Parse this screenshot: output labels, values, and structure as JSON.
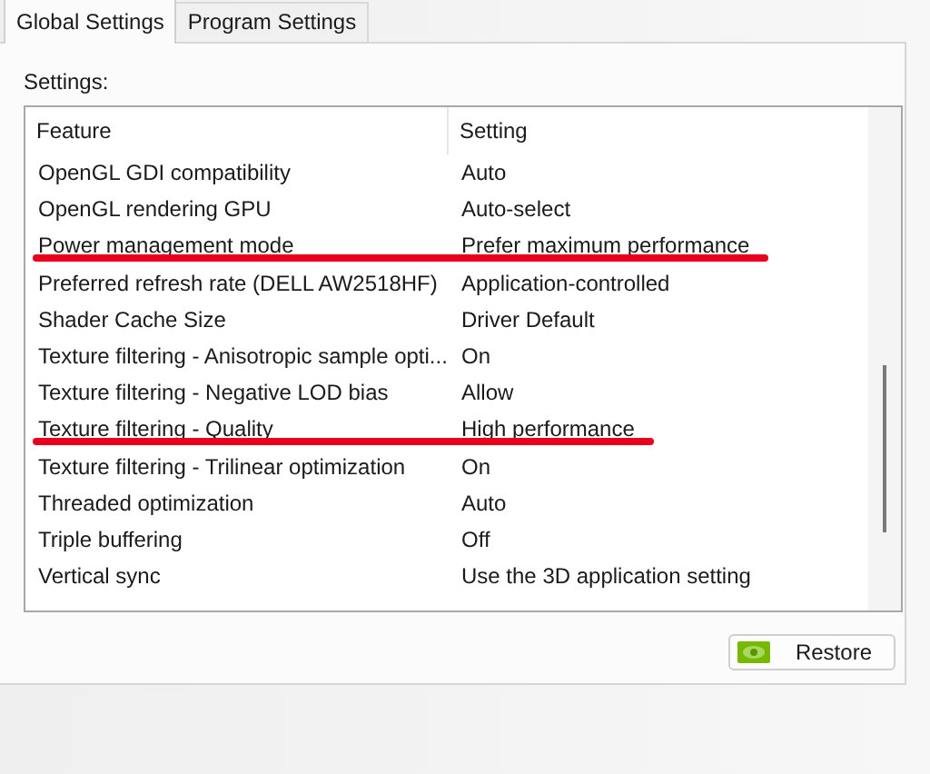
{
  "tabs": [
    {
      "label": "Global Settings",
      "selected": true
    },
    {
      "label": "Program Settings",
      "selected": false
    }
  ],
  "settings_label": "Settings:",
  "table": {
    "columns": [
      "Feature",
      "Setting"
    ],
    "rows": [
      {
        "feature": "OpenGL GDI compatibility",
        "setting": "Auto",
        "highlighted": false
      },
      {
        "feature": "OpenGL rendering GPU",
        "setting": "Auto-select",
        "highlighted": false
      },
      {
        "feature": "Power management mode",
        "setting": "Prefer maximum performance",
        "highlighted": true
      },
      {
        "feature": "Preferred refresh rate (DELL AW2518HF)",
        "setting": "Application-controlled",
        "highlighted": false
      },
      {
        "feature": "Shader Cache Size",
        "setting": "Driver Default",
        "highlighted": false
      },
      {
        "feature": "Texture filtering - Anisotropic sample opti...",
        "setting": "On",
        "highlighted": false
      },
      {
        "feature": "Texture filtering - Negative LOD bias",
        "setting": "Allow",
        "highlighted": false
      },
      {
        "feature": "Texture filtering - Quality",
        "setting": "High performance",
        "highlighted": true
      },
      {
        "feature": "Texture filtering - Trilinear optimization",
        "setting": "On",
        "highlighted": false
      },
      {
        "feature": "Threaded optimization",
        "setting": "Auto",
        "highlighted": false
      },
      {
        "feature": "Triple buffering",
        "setting": "Off",
        "highlighted": false
      },
      {
        "feature": "Vertical sync",
        "setting": "Use the 3D application setting",
        "highlighted": false
      }
    ]
  },
  "restore_button": "Restore"
}
